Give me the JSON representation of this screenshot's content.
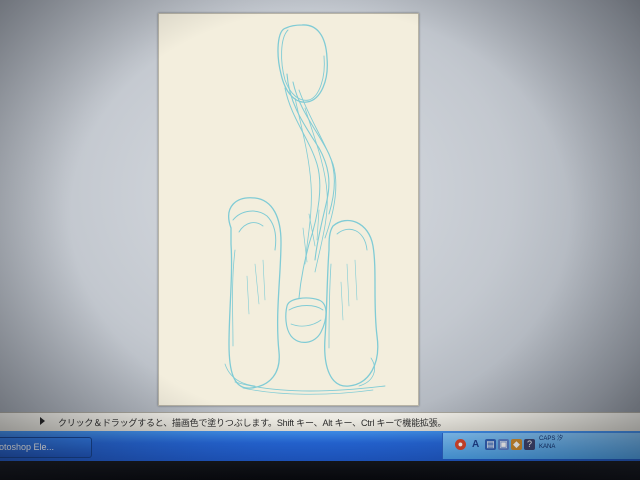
{
  "status_bar": {
    "hint_text": "クリック＆ドラッグすると、描画色で塗りつぶします。Shift キー、Alt キー、Ctrl キーで機能拡張。"
  },
  "taskbar": {
    "active_task_label": "otoshop Ele...",
    "tray": {
      "ime_indicator": "A",
      "clock_line1": "CAPS 汐",
      "clock_line2": "KANA"
    }
  },
  "canvas": {
    "drawing_color": "#6cc6d4",
    "paper_color": "#f3eedd"
  }
}
